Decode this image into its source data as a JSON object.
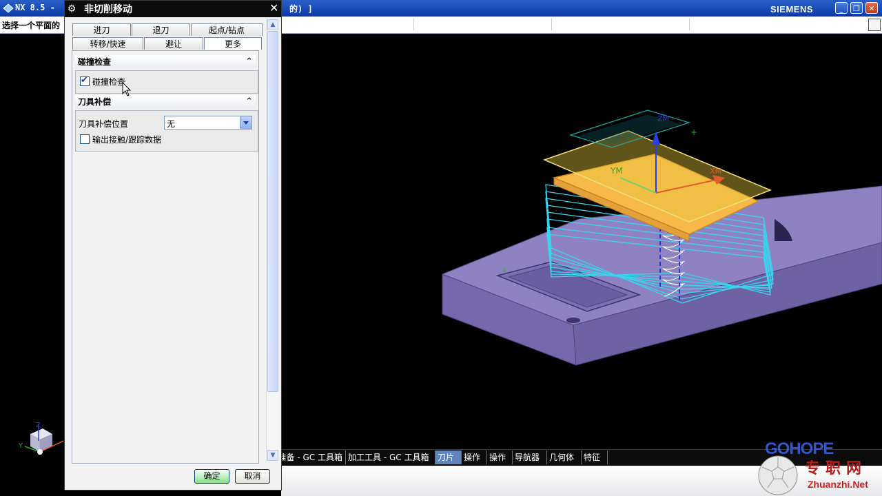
{
  "window": {
    "app_title": "NX 8.5 -",
    "doc_title": "的)  ]",
    "brand": "SIEMENS",
    "buttons": {
      "minimize": "_",
      "restore": "❐",
      "close": "✕"
    }
  },
  "cue_line": {
    "prompt": "选择一个平面的"
  },
  "dialog": {
    "title": "非切削移动",
    "close": "✕",
    "tabs_row1": [
      "进刀",
      "退刀",
      "起点/钻点"
    ],
    "tabs_row2": [
      "转移/快速",
      "避让",
      "更多"
    ],
    "active_tab": "更多",
    "groups": {
      "collision": {
        "header": "碰撞检查",
        "checkbox_label": "碰撞检查",
        "checked": true
      },
      "cutter_comp": {
        "header": "刀具补偿",
        "position_label": "刀具补偿位置",
        "position_value": "无",
        "output_label": "输出接触/跟踪数据",
        "output_checked": false
      }
    },
    "ok_label": "确定",
    "cancel_label": "取消"
  },
  "resource_tabs": [
    "准备 - GC 工具箱",
    "加工工具 - GC 工具箱",
    "刀片",
    "操作",
    "操作",
    "导航器",
    "几何体",
    "特征"
  ],
  "active_resource_tab": "刀片",
  "viewport": {
    "axis_labels": {
      "zm": "ZM",
      "ym": "YM",
      "xm": "XM"
    },
    "triad_labels": {
      "z": "Z",
      "y": "Y"
    }
  },
  "watermark": {
    "logo": "GOHOPE",
    "chinese": "专职网",
    "url": "Zhuanzhi.Net"
  },
  "colors": {
    "titlebar": "#0a3aa6",
    "part_body": "#8e82c2",
    "toolpath": "#37d5ee",
    "blank_top": "#f7b948",
    "clearance_plane": "#e8c840"
  }
}
